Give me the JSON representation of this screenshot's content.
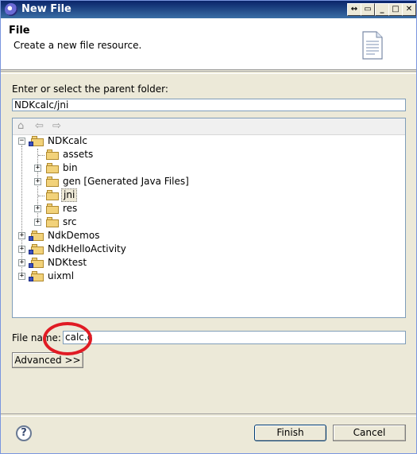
{
  "window": {
    "title": "New File"
  },
  "header": {
    "title": "File",
    "description": "Create a new file resource."
  },
  "parent": {
    "label": "Enter or select the parent folder:",
    "value": "NDKcalc/jni"
  },
  "tree": {
    "toolbar": {
      "home": "⌂",
      "back": "⇦",
      "forward": "⇨"
    },
    "items": [
      {
        "label": "NDKcalc"
      },
      {
        "label": "assets"
      },
      {
        "label": "bin"
      },
      {
        "label": "gen [Generated Java Files]"
      },
      {
        "label": "jni"
      },
      {
        "label": "res"
      },
      {
        "label": "src"
      },
      {
        "label": "NdkDemos"
      },
      {
        "label": "NdkHelloActivity"
      },
      {
        "label": "NDKtest"
      },
      {
        "label": "uixml"
      }
    ]
  },
  "file_name": {
    "label": "File name:",
    "value": "calc.c"
  },
  "buttons": {
    "advanced": "Advanced >>",
    "finish": "Finish",
    "cancel": "Cancel",
    "help": "?"
  },
  "colors": {
    "title_bar": "#0a246a",
    "annotation": "#e01b24"
  }
}
